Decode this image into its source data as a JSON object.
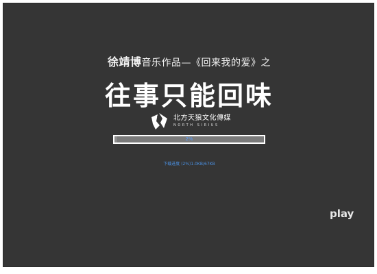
{
  "header": {
    "artist": "徐靖博",
    "subtitle_rest": "音乐作品—《回来我的爱》之",
    "title": "往事只能回味"
  },
  "logo": {
    "name_cn": "北方天狼文化傳媒",
    "name_en": "NORTH SIRIUS"
  },
  "loader": {
    "progress": 0.02,
    "percent_label": "2%",
    "status_text": "下载进度 (2%)1.0KB/67KB"
  },
  "controls": {
    "play_label": "play"
  },
  "colors": {
    "stage_bg": "#353535",
    "accent_blue": "#4a90e2"
  }
}
